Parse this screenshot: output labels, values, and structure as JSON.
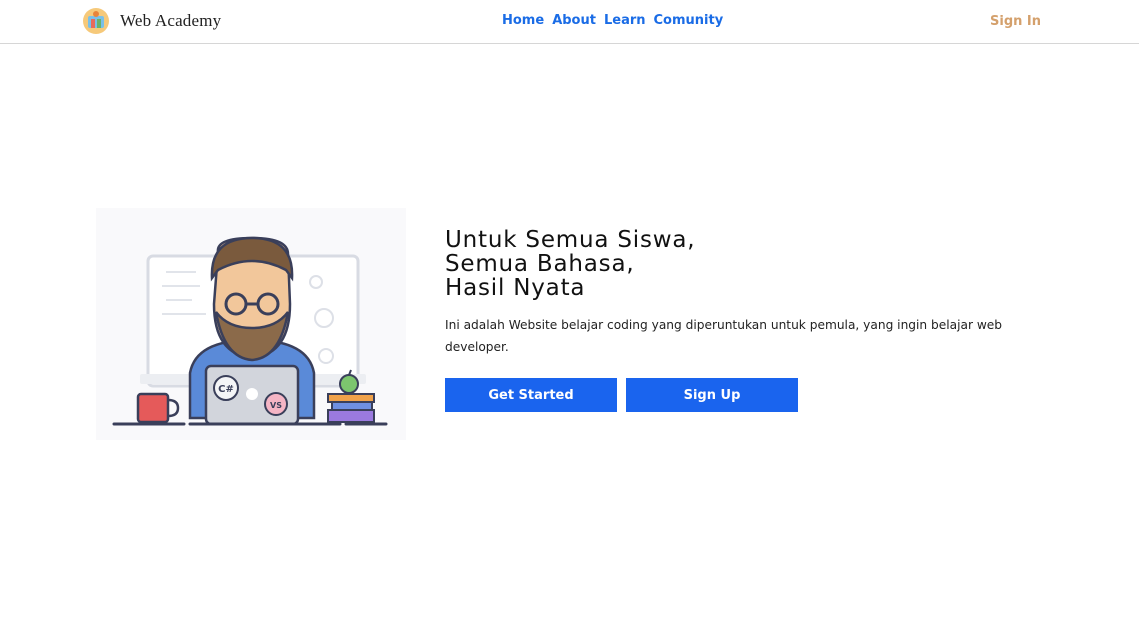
{
  "brand": {
    "name": "Web Academy",
    "logo_icon": "academy-logo-icon"
  },
  "nav": {
    "links": [
      {
        "label": "Home"
      },
      {
        "label": "About"
      },
      {
        "label": "Learn"
      },
      {
        "label": "Comunity"
      }
    ],
    "sign_in": "Sign In"
  },
  "hero": {
    "headline": [
      "Untuk Semua Siswa,",
      "Semua Bahasa,",
      "Hasil Nyata"
    ],
    "description": "Ini adalah Website belajar coding yang diperuntukan untuk pemula, yang ingin belajar web developer.",
    "illustration": "developer-at-laptop-illustration",
    "laptop_stickers": [
      "C#",
      "VS"
    ],
    "buttons": {
      "primary": "Get Started",
      "secondary": "Sign Up"
    }
  },
  "colors": {
    "accent": "#1a64ee",
    "nav_link": "#1a6ce6",
    "sign_in": "#d4a06c"
  }
}
